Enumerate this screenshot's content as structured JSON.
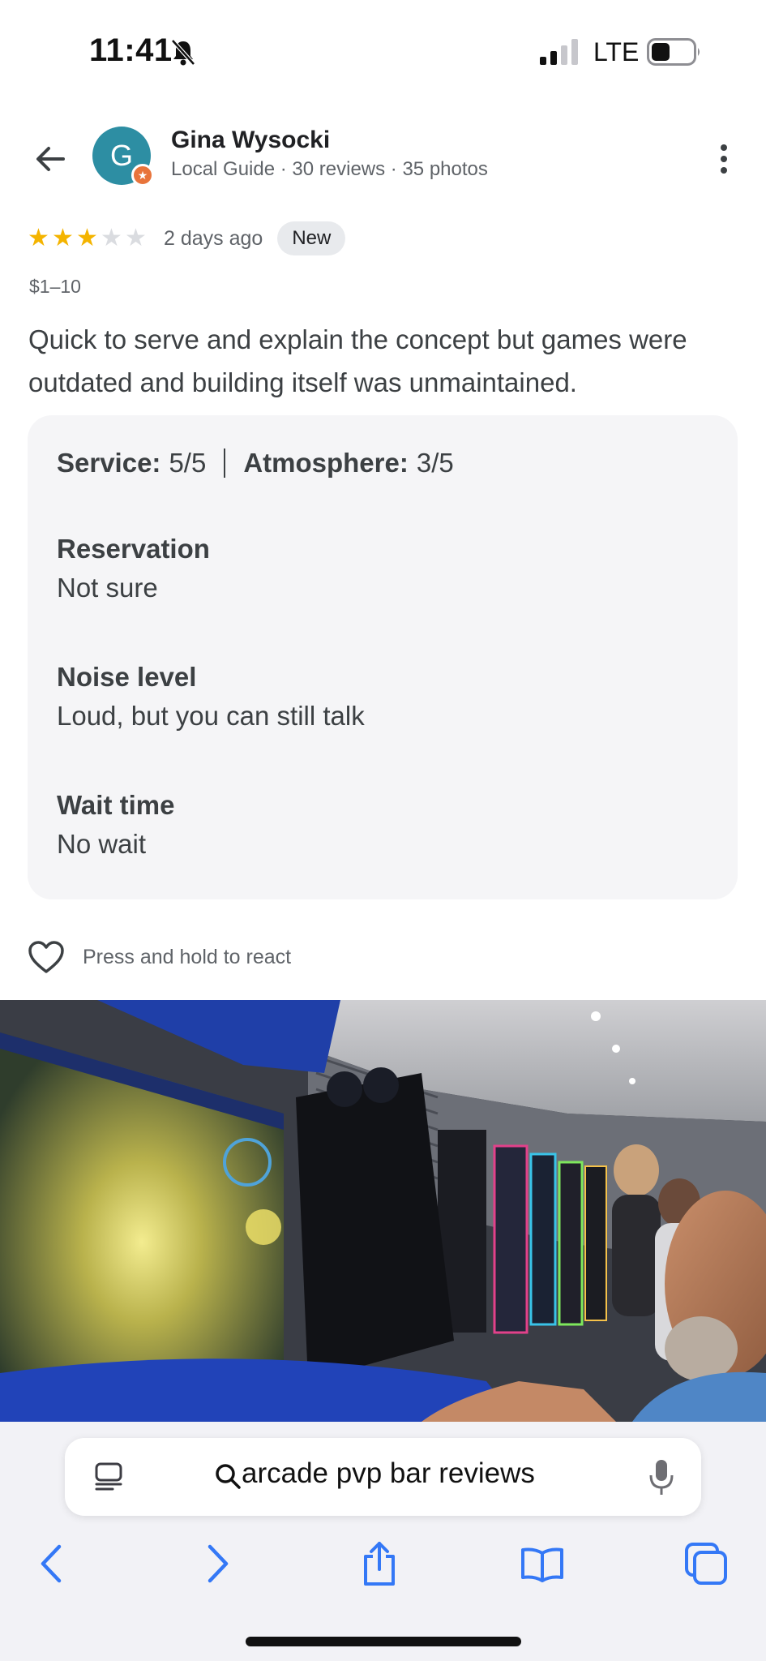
{
  "status_bar": {
    "time": "11:41",
    "network": "LTE",
    "icons": [
      "bell-off-icon",
      "cellular-signal-icon",
      "battery-icon"
    ]
  },
  "header": {
    "avatar_initial": "G",
    "reviewer_name": "Gina Wysocki",
    "reviewer_meta": "Local Guide · 30 reviews · 35 photos",
    "icons": [
      "back-arrow-icon",
      "more-vert-icon",
      "local-guide-star-icon"
    ]
  },
  "review": {
    "rating": 3,
    "rating_max": 5,
    "date": "2 days ago",
    "badge": "New",
    "price": "$1–10",
    "text": "Quick to serve and explain the concept but games were outdated and building itself was unmaintained."
  },
  "attributes": {
    "service_label": "Service:",
    "service_value": "5/5",
    "atmosphere_label": "Atmosphere:",
    "atmosphere_value": "3/5",
    "items": [
      {
        "title": "Reservation",
        "value": "Not sure"
      },
      {
        "title": "Noise level",
        "value": "Loud, but you can still talk"
      },
      {
        "title": "Wait time",
        "value": "No wait"
      }
    ]
  },
  "react": {
    "label": "Press and hold to react",
    "icon": "heart-outline-icon"
  },
  "photo": {
    "subject": "arcade-interior-photo"
  },
  "browser": {
    "url_text": "arcade pvp bar reviews",
    "icons": [
      "reader-mode-icon",
      "search-icon",
      "microphone-icon",
      "back-icon",
      "forward-icon",
      "share-icon",
      "bookmarks-icon",
      "tabs-icon"
    ],
    "accent_color": "#3478f6"
  }
}
